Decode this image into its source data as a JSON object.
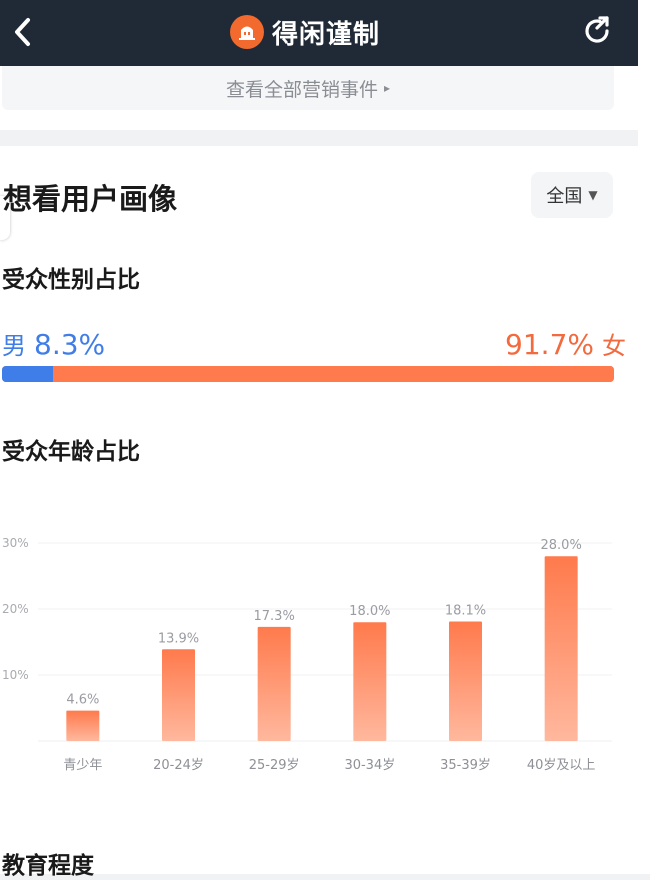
{
  "header": {
    "title": "得闲谨制",
    "back_icon": "back-icon",
    "share_icon": "share-icon"
  },
  "events": {
    "label": "查看全部营销事件",
    "arrow": "▸"
  },
  "portrait": {
    "title": "想看用户画像",
    "region": {
      "label": "全国",
      "caret": "▼"
    }
  },
  "gender": {
    "title": "受众性别占比",
    "male": {
      "label": "男",
      "pct_text": "8.3%",
      "value": 8.3,
      "color": "#3f7de8"
    },
    "female": {
      "label": "女",
      "pct_text": "91.7%",
      "value": 91.7,
      "color": "#ff7a4c"
    }
  },
  "age": {
    "title": "受众年龄占比"
  },
  "education": {
    "title": "教育程度"
  },
  "chart_data": {
    "type": "bar",
    "title": "受众年龄占比",
    "categories": [
      "青少年",
      "20-24岁",
      "25-29岁",
      "30-34岁",
      "35-39岁",
      "40岁及以上"
    ],
    "values": [
      4.6,
      13.9,
      17.3,
      18.0,
      18.1,
      28.0
    ],
    "value_labels": [
      "4.6%",
      "13.9%",
      "17.3%",
      "18.0%",
      "18.1%",
      "28.0%"
    ],
    "y_ticks": [
      "30%",
      "20%",
      "10%"
    ],
    "ylim": [
      0,
      30
    ],
    "grid": true,
    "bar_color_top": "#ff7a4c",
    "bar_color_bottom": "#ffb89e"
  }
}
